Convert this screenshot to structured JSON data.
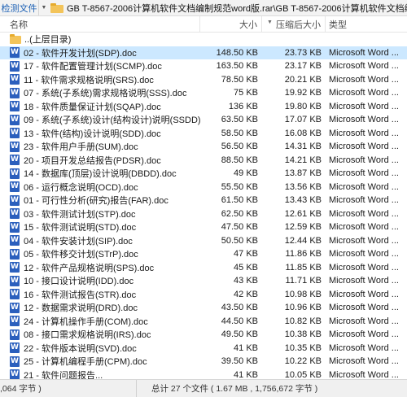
{
  "toolbar": {
    "check_label": "检测文件",
    "path": "GB T-8567-2006计算机软件文档编制规范word版.rar\\GB T-8567-2006计算机软件文档编制规范wo"
  },
  "columns": {
    "name": "名称",
    "size": "大小",
    "compressed": "压缩后大小",
    "type": "类型"
  },
  "parent_row": {
    "name": "..(上层目录)"
  },
  "files": [
    {
      "name": "02 - 软件开发计划(SDP).doc",
      "size": "148.50 KB",
      "compressed": "23.73 KB",
      "type": "Microsoft Word ...",
      "selected": true
    },
    {
      "name": "17 - 软件配置管理计划(SCMP).doc",
      "size": "163.50 KB",
      "compressed": "23.17 KB",
      "type": "Microsoft Word ..."
    },
    {
      "name": "11 - 软件需求规格说明(SRS).doc",
      "size": "78.50 KB",
      "compressed": "20.21 KB",
      "type": "Microsoft Word ..."
    },
    {
      "name": "07 - 系统(子系统)需求规格说明(SSS).doc",
      "size": "75 KB",
      "compressed": "19.92 KB",
      "type": "Microsoft Word ..."
    },
    {
      "name": "18 - 软件质量保证计划(SQAP).doc",
      "size": "136 KB",
      "compressed": "19.80 KB",
      "type": "Microsoft Word ..."
    },
    {
      "name": "09 - 系统(子系统)设计(结构设计)说明(SSDD).doc",
      "size": "63.50 KB",
      "compressed": "17.07 KB",
      "type": "Microsoft Word ..."
    },
    {
      "name": "13 - 软件(结构)设计说明(SDD).doc",
      "size": "58.50 KB",
      "compressed": "16.08 KB",
      "type": "Microsoft Word ..."
    },
    {
      "name": "23 - 软件用户手册(SUM).doc",
      "size": "56.50 KB",
      "compressed": "14.31 KB",
      "type": "Microsoft Word ..."
    },
    {
      "name": "20 - 项目开发总结报告(PDSR).doc",
      "size": "88.50 KB",
      "compressed": "14.21 KB",
      "type": "Microsoft Word ..."
    },
    {
      "name": "14 - 数据库(顶层)设计说明(DBDD).doc",
      "size": "49 KB",
      "compressed": "13.87 KB",
      "type": "Microsoft Word ..."
    },
    {
      "name": "06 - 运行概念说明(OCD).doc",
      "size": "55.50 KB",
      "compressed": "13.56 KB",
      "type": "Microsoft Word ..."
    },
    {
      "name": "01 - 可行性分析(研究)报告(FAR).doc",
      "size": "61.50 KB",
      "compressed": "13.43 KB",
      "type": "Microsoft Word ..."
    },
    {
      "name": "03 - 软件测试计划(STP).doc",
      "size": "62.50 KB",
      "compressed": "12.61 KB",
      "type": "Microsoft Word ..."
    },
    {
      "name": "15 - 软件测试说明(STD).doc",
      "size": "47.50 KB",
      "compressed": "12.59 KB",
      "type": "Microsoft Word ..."
    },
    {
      "name": "04 - 软件安装计划(SIP).doc",
      "size": "50.50 KB",
      "compressed": "12.44 KB",
      "type": "Microsoft Word ..."
    },
    {
      "name": "05 - 软件移交计划(STrP).doc",
      "size": "47 KB",
      "compressed": "11.86 KB",
      "type": "Microsoft Word ..."
    },
    {
      "name": "12 - 软件产品规格说明(SPS).doc",
      "size": "45 KB",
      "compressed": "11.85 KB",
      "type": "Microsoft Word ..."
    },
    {
      "name": "10 - 接口设计说明(IDD).doc",
      "size": "43 KB",
      "compressed": "11.71 KB",
      "type": "Microsoft Word ..."
    },
    {
      "name": "16 - 软件测试报告(STR).doc",
      "size": "42 KB",
      "compressed": "10.98 KB",
      "type": "Microsoft Word ..."
    },
    {
      "name": "12 - 数据需求说明(DRD).doc",
      "size": "43.50 KB",
      "compressed": "10.96 KB",
      "type": "Microsoft Word ..."
    },
    {
      "name": "24 - 计算机操作手册(COM).doc",
      "size": "44.50 KB",
      "compressed": "10.82 KB",
      "type": "Microsoft Word ..."
    },
    {
      "name": "08 - 接口需求规格说明(IRS).doc",
      "size": "49.50 KB",
      "compressed": "10.38 KB",
      "type": "Microsoft Word ..."
    },
    {
      "name": "22 - 软件版本说明(SVD).doc",
      "size": "41 KB",
      "compressed": "10.35 KB",
      "type": "Microsoft Word ..."
    },
    {
      "name": "25 - 计算机编程手册(CPM).doc",
      "size": "39.50 KB",
      "compressed": "10.22 KB",
      "type": "Microsoft Word ..."
    },
    {
      "name": "21 - 软件问题报告...",
      "size": "41 KB",
      "compressed": "10.05 KB",
      "type": "Microsoft Word ..."
    }
  ],
  "status": {
    "left": ",064 字节 )",
    "right": "总计 27 个文件 ( 1.67 MB , 1,756,672 字节 )"
  },
  "colors": {
    "selected_row": "#cce8ff",
    "word_icon": "#2b5fbd",
    "folder": "#f3c45a",
    "check_link": "#1a5fb4"
  },
  "icons": {
    "file": "word-doc-icon",
    "parent": "folder-icon"
  }
}
